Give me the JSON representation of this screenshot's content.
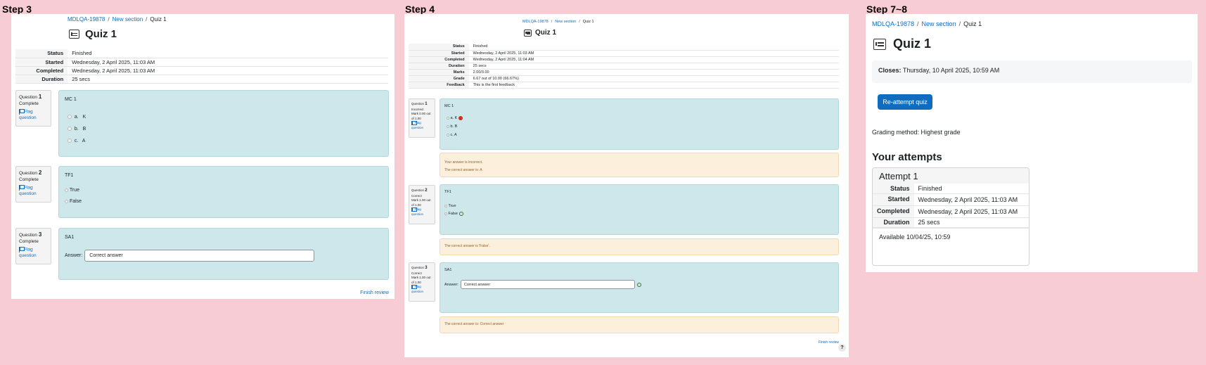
{
  "steps": {
    "step3": "Step 3",
    "step4": "Step 4",
    "step78": "Step 7~8"
  },
  "breadcrumb": {
    "course": "MDLQA-19878",
    "section": "New section",
    "current": "Quiz 1",
    "separator": "/"
  },
  "quiz_title": "Quiz 1",
  "step3": {
    "summary": [
      {
        "label": "Status",
        "value": "Finished"
      },
      {
        "label": "Started",
        "value": "Wednesday, 2 April 2025, 11:03 AM"
      },
      {
        "label": "Completed",
        "value": "Wednesday, 2 April 2025, 11:03 AM"
      },
      {
        "label": "Duration",
        "value": "25 secs"
      }
    ],
    "questions": [
      {
        "prefix": "Question",
        "num": "1",
        "state": "Complete",
        "flag": "Flag question",
        "text": "MC 1",
        "options": [
          {
            "letter": "a.",
            "text": "K"
          },
          {
            "letter": "b.",
            "text": "B"
          },
          {
            "letter": "c.",
            "text": "A"
          }
        ]
      },
      {
        "prefix": "Question",
        "num": "2",
        "state": "Complete",
        "flag": "Flag question",
        "text": "TF1",
        "options": [
          {
            "text": "True"
          },
          {
            "text": "False"
          }
        ]
      },
      {
        "prefix": "Question",
        "num": "3",
        "state": "Complete",
        "flag": "Flag question",
        "text": "SA1",
        "answer_label": "Answer:",
        "answer_value": "Correct answer"
      }
    ],
    "finish_review": "Finish review"
  },
  "step4": {
    "summary": [
      {
        "label": "Status",
        "value": "Finished"
      },
      {
        "label": "Started",
        "value": "Wednesday, 2 April 2025, 11:03 AM"
      },
      {
        "label": "Completed",
        "value": "Wednesday, 2 April 2025, 11:04 AM"
      },
      {
        "label": "Duration",
        "value": "25 secs"
      },
      {
        "label": "Marks",
        "value": "2.00/3.00"
      },
      {
        "label": "Grade",
        "value": "6.67 out of 10.00 (66.67%)"
      },
      {
        "label": "Feedback",
        "value": "This is the first feedback"
      }
    ],
    "questions": [
      {
        "prefix": "Question",
        "num": "1",
        "state": "Incorrect",
        "mark": "Mark 0.00 out of 1.00",
        "flag": "Flag question",
        "text": "MC 1",
        "options": [
          {
            "letter": "a.",
            "text": "K"
          },
          {
            "letter": "b.",
            "text": "B"
          },
          {
            "letter": "c.",
            "text": "A"
          }
        ],
        "feedback": [
          "Your answer is incorrect.",
          "The correct answer is: A"
        ]
      },
      {
        "prefix": "Question",
        "num": "2",
        "state": "Correct",
        "mark": "Mark 1.00 out of 1.00",
        "flag": "Flag question",
        "text": "TF1",
        "options": [
          {
            "text": "True"
          },
          {
            "text": "False"
          }
        ],
        "feedback": [
          "The correct answer is 'False'."
        ]
      },
      {
        "prefix": "Question",
        "num": "3",
        "state": "Correct",
        "mark": "Mark 1.00 out of 1.00",
        "flag": "Flag question",
        "text": "SA1",
        "answer_label": "Answer:",
        "answer_value": "Correct answer",
        "feedback": [
          "The correct answer is: Correct answer"
        ]
      }
    ],
    "finish_review": "Finish review",
    "help": "?"
  },
  "step78": {
    "closes_label": "Closes:",
    "closes_value": "Thursday, 10 April 2025, 10:59 AM",
    "reattempt": "Re-attempt quiz",
    "grading": "Grading method: Highest grade",
    "attempts_heading": "Your attempts",
    "attempt_title": "Attempt 1",
    "rows": [
      {
        "label": "Status",
        "value": "Finished"
      },
      {
        "label": "Started",
        "value": "Wednesday, 2 April 2025, 11:03 AM"
      },
      {
        "label": "Completed",
        "value": "Wednesday, 2 April 2025, 11:03 AM"
      },
      {
        "label": "Duration",
        "value": "25 secs"
      }
    ],
    "available": "Available 10/04/25, 10:59"
  },
  "colors": {
    "background": "#f8ccd4",
    "link": "#0f6cbf",
    "question_bg": "#cde7ea",
    "feedback_bg": "#fcefdc"
  }
}
